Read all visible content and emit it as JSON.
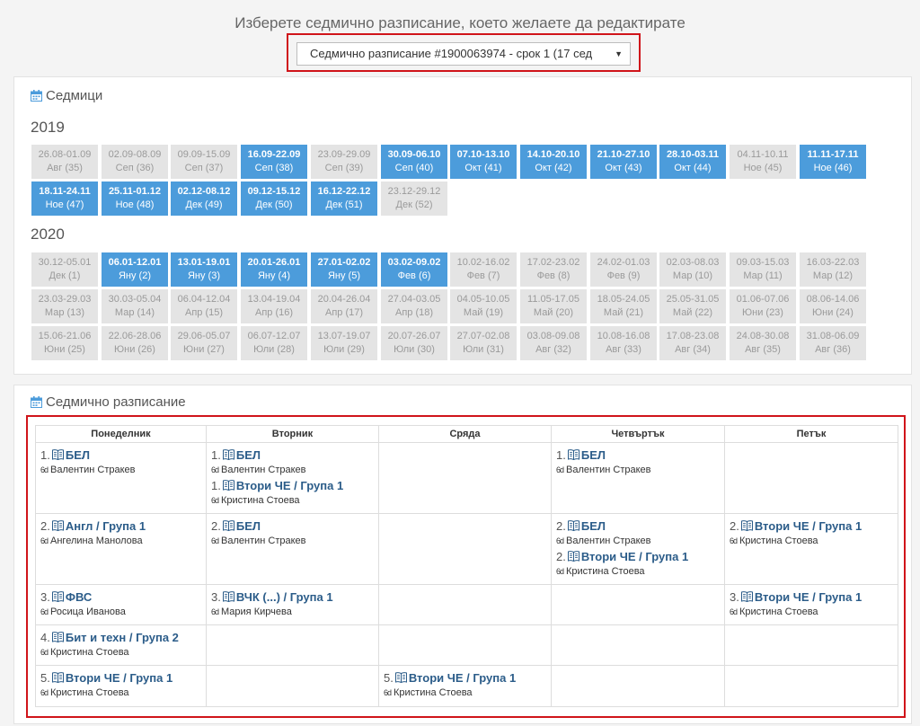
{
  "header": {
    "title": "Изберете седмично разписание, което желаете да редактирате",
    "select_value": "Седмично разписание #1900063974 - срок 1 (17 сед",
    "select_arrow": "▼"
  },
  "weeks_panel": {
    "title": "Седмици",
    "years": [
      {
        "year": "2019",
        "weeks": [
          {
            "range": "26.08-01.09",
            "label": "Авг (35)",
            "active": false
          },
          {
            "range": "02.09-08.09",
            "label": "Сеп (36)",
            "active": false
          },
          {
            "range": "09.09-15.09",
            "label": "Сеп (37)",
            "active": false
          },
          {
            "range": "16.09-22.09",
            "label": "Сеп (38)",
            "active": true
          },
          {
            "range": "23.09-29.09",
            "label": "Сеп (39)",
            "active": false
          },
          {
            "range": "30.09-06.10",
            "label": "Сеп (40)",
            "active": true
          },
          {
            "range": "07.10-13.10",
            "label": "Окт (41)",
            "active": true
          },
          {
            "range": "14.10-20.10",
            "label": "Окт (42)",
            "active": true
          },
          {
            "range": "21.10-27.10",
            "label": "Окт (43)",
            "active": true
          },
          {
            "range": "28.10-03.11",
            "label": "Окт (44)",
            "active": true
          },
          {
            "range": "04.11-10.11",
            "label": "Ное (45)",
            "active": false
          },
          {
            "range": "11.11-17.11",
            "label": "Ное (46)",
            "active": true
          },
          {
            "range": "18.11-24.11",
            "label": "Ное (47)",
            "active": true
          },
          {
            "range": "25.11-01.12",
            "label": "Ное (48)",
            "active": true
          },
          {
            "range": "02.12-08.12",
            "label": "Дек (49)",
            "active": true
          },
          {
            "range": "09.12-15.12",
            "label": "Дек (50)",
            "active": true
          },
          {
            "range": "16.12-22.12",
            "label": "Дек (51)",
            "active": true
          },
          {
            "range": "23.12-29.12",
            "label": "Дек (52)",
            "active": false
          }
        ]
      },
      {
        "year": "2020",
        "weeks": [
          {
            "range": "30.12-05.01",
            "label": "Дек (1)",
            "active": false
          },
          {
            "range": "06.01-12.01",
            "label": "Яну (2)",
            "active": true
          },
          {
            "range": "13.01-19.01",
            "label": "Яну (3)",
            "active": true
          },
          {
            "range": "20.01-26.01",
            "label": "Яну (4)",
            "active": true
          },
          {
            "range": "27.01-02.02",
            "label": "Яну (5)",
            "active": true
          },
          {
            "range": "03.02-09.02",
            "label": "Фев (6)",
            "active": true
          },
          {
            "range": "10.02-16.02",
            "label": "Фев (7)",
            "active": false
          },
          {
            "range": "17.02-23.02",
            "label": "Фев (8)",
            "active": false
          },
          {
            "range": "24.02-01.03",
            "label": "Фев (9)",
            "active": false
          },
          {
            "range": "02.03-08.03",
            "label": "Мар (10)",
            "active": false
          },
          {
            "range": "09.03-15.03",
            "label": "Мар (11)",
            "active": false
          },
          {
            "range": "16.03-22.03",
            "label": "Мар (12)",
            "active": false
          },
          {
            "range": "23.03-29.03",
            "label": "Мар (13)",
            "active": false
          },
          {
            "range": "30.03-05.04",
            "label": "Мар (14)",
            "active": false
          },
          {
            "range": "06.04-12.04",
            "label": "Апр (15)",
            "active": false
          },
          {
            "range": "13.04-19.04",
            "label": "Апр (16)",
            "active": false
          },
          {
            "range": "20.04-26.04",
            "label": "Апр (17)",
            "active": false
          },
          {
            "range": "27.04-03.05",
            "label": "Апр (18)",
            "active": false
          },
          {
            "range": "04.05-10.05",
            "label": "Май (19)",
            "active": false
          },
          {
            "range": "11.05-17.05",
            "label": "Май (20)",
            "active": false
          },
          {
            "range": "18.05-24.05",
            "label": "Май (21)",
            "active": false
          },
          {
            "range": "25.05-31.05",
            "label": "Май (22)",
            "active": false
          },
          {
            "range": "01.06-07.06",
            "label": "Юни (23)",
            "active": false
          },
          {
            "range": "08.06-14.06",
            "label": "Юни (24)",
            "active": false
          },
          {
            "range": "15.06-21.06",
            "label": "Юни (25)",
            "active": false
          },
          {
            "range": "22.06-28.06",
            "label": "Юни (26)",
            "active": false
          },
          {
            "range": "29.06-05.07",
            "label": "Юни (27)",
            "active": false
          },
          {
            "range": "06.07-12.07",
            "label": "Юли (28)",
            "active": false
          },
          {
            "range": "13.07-19.07",
            "label": "Юли (29)",
            "active": false
          },
          {
            "range": "20.07-26.07",
            "label": "Юли (30)",
            "active": false
          },
          {
            "range": "27.07-02.08",
            "label": "Юли (31)",
            "active": false
          },
          {
            "range": "03.08-09.08",
            "label": "Авг (32)",
            "active": false
          },
          {
            "range": "10.08-16.08",
            "label": "Авг (33)",
            "active": false
          },
          {
            "range": "17.08-23.08",
            "label": "Авг (34)",
            "active": false
          },
          {
            "range": "24.08-30.08",
            "label": "Авг (35)",
            "active": false
          },
          {
            "range": "31.08-06.09",
            "label": "Авг (36)",
            "active": false
          }
        ]
      }
    ]
  },
  "schedule_panel": {
    "title": "Седмично разписание",
    "days": [
      "Понеделник",
      "Вторник",
      "Сряда",
      "Четвъртък",
      "Петък"
    ],
    "rows": [
      [
        [
          {
            "num": "1.",
            "subject": "БЕЛ",
            "teacher": "Валентин Стракев"
          }
        ],
        [
          {
            "num": "1.",
            "subject": "БЕЛ",
            "teacher": "Валентин Стракев"
          },
          {
            "num": "1.",
            "subject": "Втори ЧЕ / Група 1",
            "teacher": "Кристина Стоева"
          }
        ],
        [],
        [
          {
            "num": "1.",
            "subject": "БЕЛ",
            "teacher": "Валентин Стракев"
          }
        ],
        []
      ],
      [
        [
          {
            "num": "2.",
            "subject": "Англ / Група 1",
            "teacher": "Ангелина Манолова"
          }
        ],
        [
          {
            "num": "2.",
            "subject": "БЕЛ",
            "teacher": "Валентин Стракев"
          }
        ],
        [],
        [
          {
            "num": "2.",
            "subject": "БЕЛ",
            "teacher": "Валентин Стракев"
          },
          {
            "num": "2.",
            "subject": "Втори ЧЕ / Група 1",
            "teacher": "Кристина Стоева"
          }
        ],
        [
          {
            "num": "2.",
            "subject": "Втори ЧЕ / Група 1",
            "teacher": "Кристина Стоева"
          }
        ]
      ],
      [
        [
          {
            "num": "3.",
            "subject": "ФВС",
            "teacher": "Росица Иванова"
          }
        ],
        [
          {
            "num": "3.",
            "subject": "ВЧК (...) / Група 1",
            "teacher": "Мария Кирчева"
          }
        ],
        [],
        [],
        [
          {
            "num": "3.",
            "subject": "Втори ЧЕ / Група 1",
            "teacher": "Кристина Стоева"
          }
        ]
      ],
      [
        [
          {
            "num": "4.",
            "subject": "Бит и техн / Група 2",
            "teacher": "Кристина Стоева"
          }
        ],
        [],
        [],
        [],
        []
      ],
      [
        [
          {
            "num": "5.",
            "subject": "Втори ЧЕ / Група 1",
            "teacher": "Кристина Стоева"
          }
        ],
        [],
        [
          {
            "num": "5.",
            "subject": "Втори ЧЕ / Група 1",
            "teacher": "Кристина Стоева"
          }
        ],
        [],
        []
      ]
    ]
  },
  "icons": {
    "panel_icon": "calendar-icon",
    "lesson_icon": "book-icon",
    "teacher_icon": "glasses-icon"
  },
  "colors": {
    "active_week": "#4c9cdb",
    "inactive_week": "#e4e4e4",
    "highlight_border": "#d0141a",
    "subject_text": "#2b5c89"
  }
}
